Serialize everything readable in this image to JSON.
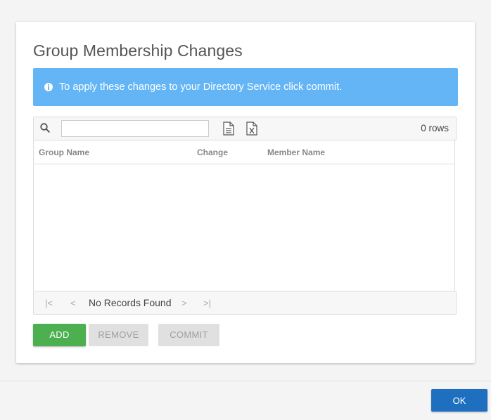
{
  "dialog": {
    "title": "Group Membership Changes",
    "alert": {
      "icon": "info-icon",
      "text": "To apply these changes to your Directory Service click commit.",
      "color": "#64b5f6"
    },
    "grid": {
      "search": {
        "icon": "search-icon",
        "value": "",
        "placeholder": ""
      },
      "export_icons": [
        "export-document-icon",
        "export-excel-icon"
      ],
      "rows_label": "0 rows",
      "columns": [
        "Group Name",
        "Change",
        "Member Name"
      ],
      "rows": [],
      "pager": {
        "first_icon": "first-page-icon",
        "prev_icon": "previous-page-icon",
        "status": "No Records Found",
        "next_icon": "next-page-icon",
        "last_icon": "last-page-icon"
      }
    },
    "actions": {
      "add_label": "ADD",
      "remove_label": "REMOVE",
      "commit_label": "COMMIT",
      "add_color": "#4caf50",
      "disabled_color": "#e0e0e0"
    }
  },
  "footer": {
    "ok_label": "OK",
    "ok_color": "#1e6fbf"
  }
}
